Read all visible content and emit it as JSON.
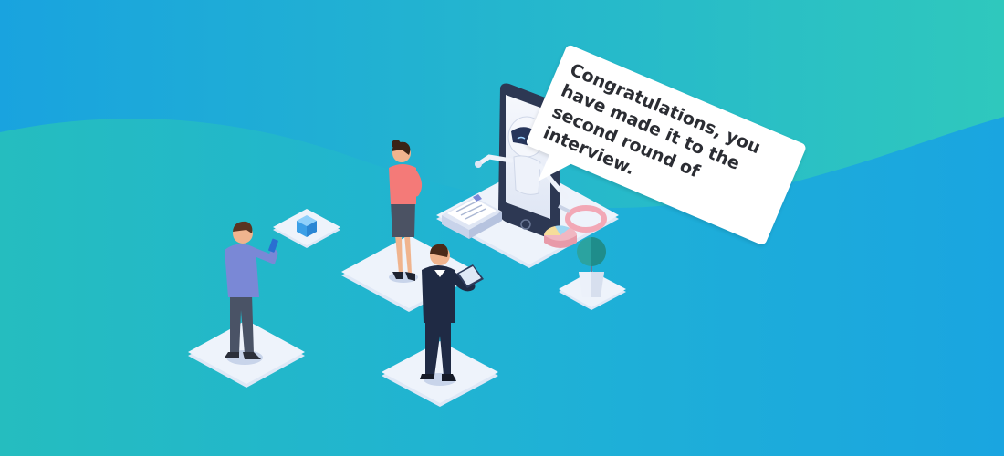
{
  "speech_bubble": {
    "text": "Congratulations, you have made it to the second round of interview."
  },
  "colors": {
    "background_left": "#1aa6e0",
    "background_right": "#2ec6bd",
    "tile": "#e8f0fb",
    "phone": "#2d3853",
    "robot_visor": "#27355a",
    "woman_top": "#f47a78",
    "man_shirt": "#7a88d6",
    "man_suit": "#1f2a44",
    "plant": "#2ba3a0",
    "chart_pink": "#f2b9c3",
    "cube": "#43a6ea"
  },
  "icons": [
    "robot-icon",
    "smartphone-icon",
    "magnifier-icon",
    "pie-chart-icon",
    "document-icon",
    "cube-icon",
    "plant-icon",
    "tablet-icon",
    "phone-icon"
  ]
}
